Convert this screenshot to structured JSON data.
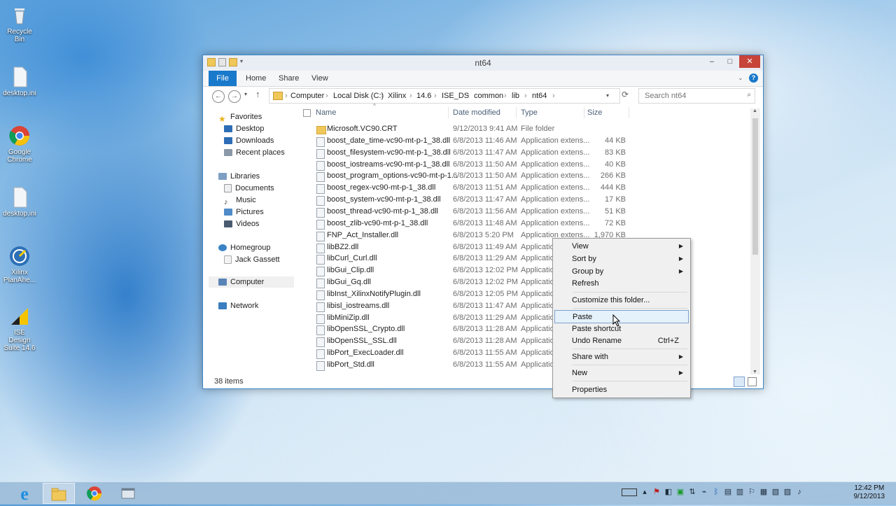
{
  "desktop": {
    "icons": [
      {
        "label": "Recycle Bin"
      },
      {
        "label": "desktop.ini"
      },
      {
        "label": "Google Chrome"
      },
      {
        "label": "desktop.ini"
      },
      {
        "label": "Xilinx PlanAhe..."
      },
      {
        "label": "ISE Design Suite 14.6"
      }
    ]
  },
  "window": {
    "title": "nt64",
    "minimize": "–",
    "maximize": "□",
    "close": "✕",
    "ribbon_tabs": [
      "File",
      "Home",
      "Share",
      "View"
    ],
    "breadcrumb": [
      "Computer",
      "Local Disk (C:)",
      "Xilinx",
      "14.6",
      "ISE_DS",
      "common",
      "lib",
      "nt64"
    ],
    "search_placeholder": "Search nt64",
    "nav": {
      "favorites": "Favorites",
      "favorite_items": [
        "Desktop",
        "Downloads",
        "Recent places"
      ],
      "libraries": "Libraries",
      "library_items": [
        "Documents",
        "Music",
        "Pictures",
        "Videos"
      ],
      "homegroup": "Homegroup",
      "homegroup_items": [
        "Jack Gassett"
      ],
      "computer": "Computer",
      "network": "Network"
    },
    "columns": {
      "name": "Name",
      "date": "Date modified",
      "type": "Type",
      "size": "Size"
    },
    "files": [
      {
        "name": "Microsoft.VC90.CRT",
        "date": "9/12/2013 9:41 AM",
        "type": "File folder",
        "size": "",
        "folder": true
      },
      {
        "name": "boost_date_time-vc90-mt-p-1_38.dll",
        "date": "6/8/2013 11:46 AM",
        "type": "Application extens...",
        "size": "44 KB"
      },
      {
        "name": "boost_filesystem-vc90-mt-p-1_38.dll",
        "date": "6/8/2013 11:47 AM",
        "type": "Application extens...",
        "size": "83 KB"
      },
      {
        "name": "boost_iostreams-vc90-mt-p-1_38.dll",
        "date": "6/8/2013 11:50 AM",
        "type": "Application extens...",
        "size": "40 KB"
      },
      {
        "name": "boost_program_options-vc90-mt-p-1...",
        "date": "6/8/2013 11:50 AM",
        "type": "Application extens...",
        "size": "266 KB"
      },
      {
        "name": "boost_regex-vc90-mt-p-1_38.dll",
        "date": "6/8/2013 11:51 AM",
        "type": "Application extens...",
        "size": "444 KB"
      },
      {
        "name": "boost_system-vc90-mt-p-1_38.dll",
        "date": "6/8/2013 11:47 AM",
        "type": "Application extens...",
        "size": "17 KB"
      },
      {
        "name": "boost_thread-vc90-mt-p-1_38.dll",
        "date": "6/8/2013 11:56 AM",
        "type": "Application extens...",
        "size": "51 KB"
      },
      {
        "name": "boost_zlib-vc90-mt-p-1_38.dll",
        "date": "6/8/2013 11:48 AM",
        "type": "Application extens...",
        "size": "72 KB"
      },
      {
        "name": "FNP_Act_Installer.dll",
        "date": "6/8/2013 5:20 PM",
        "type": "Application extens...",
        "size": "1,970 KB"
      },
      {
        "name": "libBZ2.dll",
        "date": "6/8/2013 11:49 AM",
        "type": "Application",
        "size": ""
      },
      {
        "name": "libCurl_Curl.dll",
        "date": "6/8/2013 11:29 AM",
        "type": "Application",
        "size": ""
      },
      {
        "name": "libGui_Clip.dll",
        "date": "6/8/2013 12:02 PM",
        "type": "Application",
        "size": ""
      },
      {
        "name": "libGui_Gq.dll",
        "date": "6/8/2013 12:02 PM",
        "type": "Application",
        "size": ""
      },
      {
        "name": "libInst_XilinxNotifyPlugin.dll",
        "date": "6/8/2013 12:05 PM",
        "type": "Application",
        "size": ""
      },
      {
        "name": "libisl_iostreams.dll",
        "date": "6/8/2013 11:47 AM",
        "type": "Application",
        "size": ""
      },
      {
        "name": "libMiniZip.dll",
        "date": "6/8/2013 11:29 AM",
        "type": "Application",
        "size": ""
      },
      {
        "name": "libOpenSSL_Crypto.dll",
        "date": "6/8/2013 11:28 AM",
        "type": "Application",
        "size": ""
      },
      {
        "name": "libOpenSSL_SSL.dll",
        "date": "6/8/2013 11:28 AM",
        "type": "Application",
        "size": ""
      },
      {
        "name": "libPort_ExecLoader.dll",
        "date": "6/8/2013 11:55 AM",
        "type": "Application",
        "size": ""
      },
      {
        "name": "libPort_Std.dll",
        "date": "6/8/2013 11:55 AM",
        "type": "Application",
        "size": ""
      }
    ],
    "status": "38 items"
  },
  "context_menu": {
    "items": [
      {
        "label": "View",
        "submenu": true
      },
      {
        "label": "Sort by",
        "submenu": true
      },
      {
        "label": "Group by",
        "submenu": true
      },
      {
        "label": "Refresh"
      },
      {
        "sep": true
      },
      {
        "label": "Customize this folder..."
      },
      {
        "sep": true
      },
      {
        "label": "Paste",
        "highlight": true
      },
      {
        "label": "Paste shortcut"
      },
      {
        "label": "Undo Rename",
        "shortcut": "Ctrl+Z"
      },
      {
        "sep": true
      },
      {
        "label": "Share with",
        "submenu": true
      },
      {
        "sep": true
      },
      {
        "label": "New",
        "submenu": true
      },
      {
        "sep": true
      },
      {
        "label": "Properties"
      }
    ]
  },
  "taskbar": {
    "clock_time": "12:42 PM",
    "clock_date": "9/12/2013"
  },
  "colors": {
    "file_tab": "#1979ca",
    "window_border": "#3d87c8",
    "menu_highlight": "#e5f1fb"
  }
}
